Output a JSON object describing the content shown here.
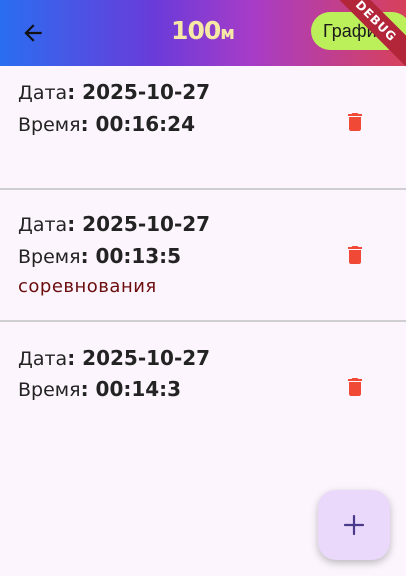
{
  "appbar": {
    "title_main": "100",
    "title_unit": "м",
    "graph_button_label": "Графи",
    "debug_banner": "DEBUG"
  },
  "records": [
    {
      "date_label": "Дата",
      "date_value": ": 2025-10-27",
      "time_label": "Время",
      "time_value": ": 00:16:24",
      "note": ""
    },
    {
      "date_label": "Дата",
      "date_value": ": 2025-10-27",
      "time_label": "Время",
      "time_value": ": 00:13:5",
      "note": "соревнования"
    },
    {
      "date_label": "Дата",
      "date_value": ": 2025-10-27",
      "time_label": "Время",
      "time_value": ": 00:14:3",
      "note": ""
    }
  ],
  "icons": {
    "back": "arrow-back-icon",
    "delete": "trash-icon",
    "add": "plus-icon"
  },
  "colors": {
    "delete": "#f04a36",
    "note": "#6b0d0d",
    "fab_bg": "#ead9fb",
    "fab_icon": "#4a3a8a",
    "graph_button_bg": "#bcf05a",
    "title": "#f6e9a6"
  }
}
